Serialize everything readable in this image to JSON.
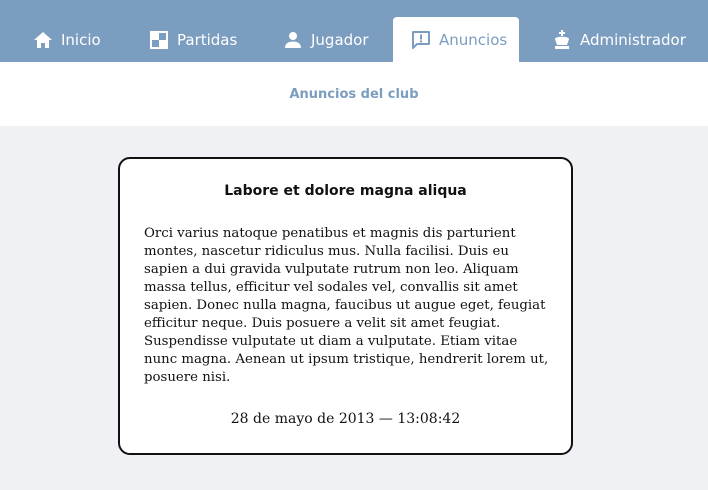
{
  "nav": {
    "tabs": [
      {
        "label": "Inicio",
        "icon": "home-icon"
      },
      {
        "label": "Partidas",
        "icon": "board-icon"
      },
      {
        "label": "Jugador",
        "icon": "user-icon"
      },
      {
        "label": "Anuncios",
        "icon": "announcement-icon",
        "active": true
      },
      {
        "label": "Administrador",
        "icon": "king-icon"
      }
    ]
  },
  "subheader": {
    "title": "Anuncios del club"
  },
  "announcement": {
    "title": "Labore et dolore magna aliqua",
    "body": "Orci varius natoque penatibus et magnis dis parturient montes, nascetur ridiculus mus. Nulla facilisi. Duis eu sapien a dui gravida vulputate rutrum non leo. Aliquam massa tellus, efficitur vel sodales vel, convallis sit amet sapien. Donec nulla magna, faucibus ut augue eget, feugiat efficitur neque. Duis posuere a velit sit amet feugiat. Suspendisse vulputate ut diam a vulputate. Etiam vitae nunc magna. Aenean ut ipsum tristique, hendrerit lorem ut, posuere nisi.",
    "date": "28 de mayo de 2013 — 13:08:42"
  },
  "colors": {
    "nav_background": "#7b9dc0",
    "page_background": "#f0f1f5",
    "accent_text": "#7b9dc0"
  }
}
